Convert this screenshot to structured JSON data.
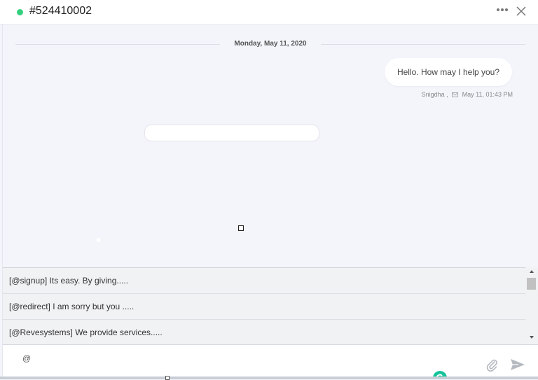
{
  "header": {
    "ticket_id": "#524410002",
    "status_color": "#35d07f",
    "more_icon": "ellipsis-icon",
    "close_icon": "close-icon"
  },
  "conversation": {
    "date_separator": "Monday, May 11, 2020",
    "messages": [
      {
        "text": "Hello. How may I help you?",
        "sender": "Snigdha ,",
        "timestamp": "May 11, 01:43 PM",
        "status_icon": "mail-icon"
      }
    ]
  },
  "suggestions": [
    {
      "label": "[@signup] Its easy. By giving....."
    },
    {
      "label": "[@redirect] I am sorry but you ....."
    },
    {
      "label": "[@Revesystems] We provide services....."
    }
  ],
  "composer": {
    "value": "@",
    "attach_icon": "paperclip-icon",
    "send_icon": "send-icon",
    "grammar_icon": "grammarly-icon",
    "grammar_color": "#15c39a"
  }
}
